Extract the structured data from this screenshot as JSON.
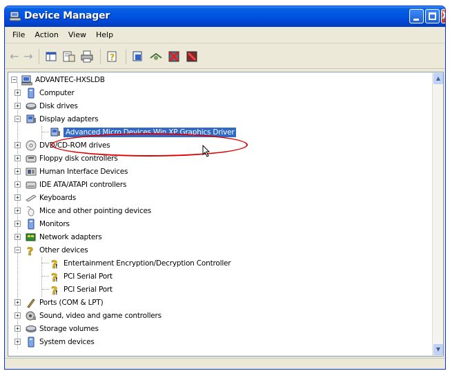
{
  "window": {
    "title": "Device Manager"
  },
  "menu": [
    "File",
    "Action",
    "View",
    "Help"
  ],
  "toolbar": {
    "icons": [
      "back-arrow-icon",
      "forward-arrow-icon",
      "show-hide-console-tree-icon",
      "properties-icon",
      "print-icon",
      "help-icon",
      "update-driver-icon",
      "scan-hardware-icon",
      "disable-device-icon",
      "uninstall-device-icon"
    ]
  },
  "tree": {
    "root": "ADVANTEC-HXSLDB",
    "nodes": [
      {
        "label": "Computer",
        "icon": "computer-icon",
        "expander": "+"
      },
      {
        "label": "Disk drives",
        "icon": "disk-drive-icon",
        "expander": "+"
      },
      {
        "label": "Display adapters",
        "icon": "display-adapter-icon",
        "expander": "-"
      },
      {
        "label": "Advanced Micro Devices Win XP Graphics Driver",
        "icon": "display-adapter-icon",
        "child": true,
        "selected": true
      },
      {
        "label": "DVD/CD-ROM drives",
        "icon": "cdrom-icon",
        "expander": "+"
      },
      {
        "label": "Floppy disk controllers",
        "icon": "floppy-controller-icon",
        "expander": "+"
      },
      {
        "label": "Human Interface Devices",
        "icon": "hid-icon",
        "expander": "+"
      },
      {
        "label": "IDE ATA/ATAPI controllers",
        "icon": "ide-controller-icon",
        "expander": "+"
      },
      {
        "label": "Keyboards",
        "icon": "keyboard-icon",
        "expander": "+"
      },
      {
        "label": "Mice and other pointing devices",
        "icon": "mouse-icon",
        "expander": "+"
      },
      {
        "label": "Monitors",
        "icon": "monitor-icon",
        "expander": "+"
      },
      {
        "label": "Network adapters",
        "icon": "network-adapter-icon",
        "expander": "+"
      },
      {
        "label": "Other devices",
        "icon": "unknown-device-icon",
        "expander": "-"
      },
      {
        "label": "Entertainment Encryption/Decryption Controller",
        "icon": "unknown-device-warning-icon",
        "child": true
      },
      {
        "label": "PCI Serial Port",
        "icon": "unknown-device-warning-icon",
        "child": true
      },
      {
        "label": "PCI Serial Port",
        "icon": "unknown-device-warning-icon",
        "child": true
      },
      {
        "label": "Ports (COM & LPT)",
        "icon": "port-icon",
        "expander": "+"
      },
      {
        "label": "Sound, video and game controllers",
        "icon": "sound-icon",
        "expander": "+"
      },
      {
        "label": "Storage volumes",
        "icon": "storage-volume-icon",
        "expander": "+"
      },
      {
        "label": "System devices",
        "icon": "system-device-icon",
        "expander": "+"
      }
    ]
  },
  "colors": {
    "titlebar": "#0054e3",
    "selection": "#316ac5",
    "highlight_ellipse": "#e00000",
    "chrome": "#ece9d8"
  }
}
